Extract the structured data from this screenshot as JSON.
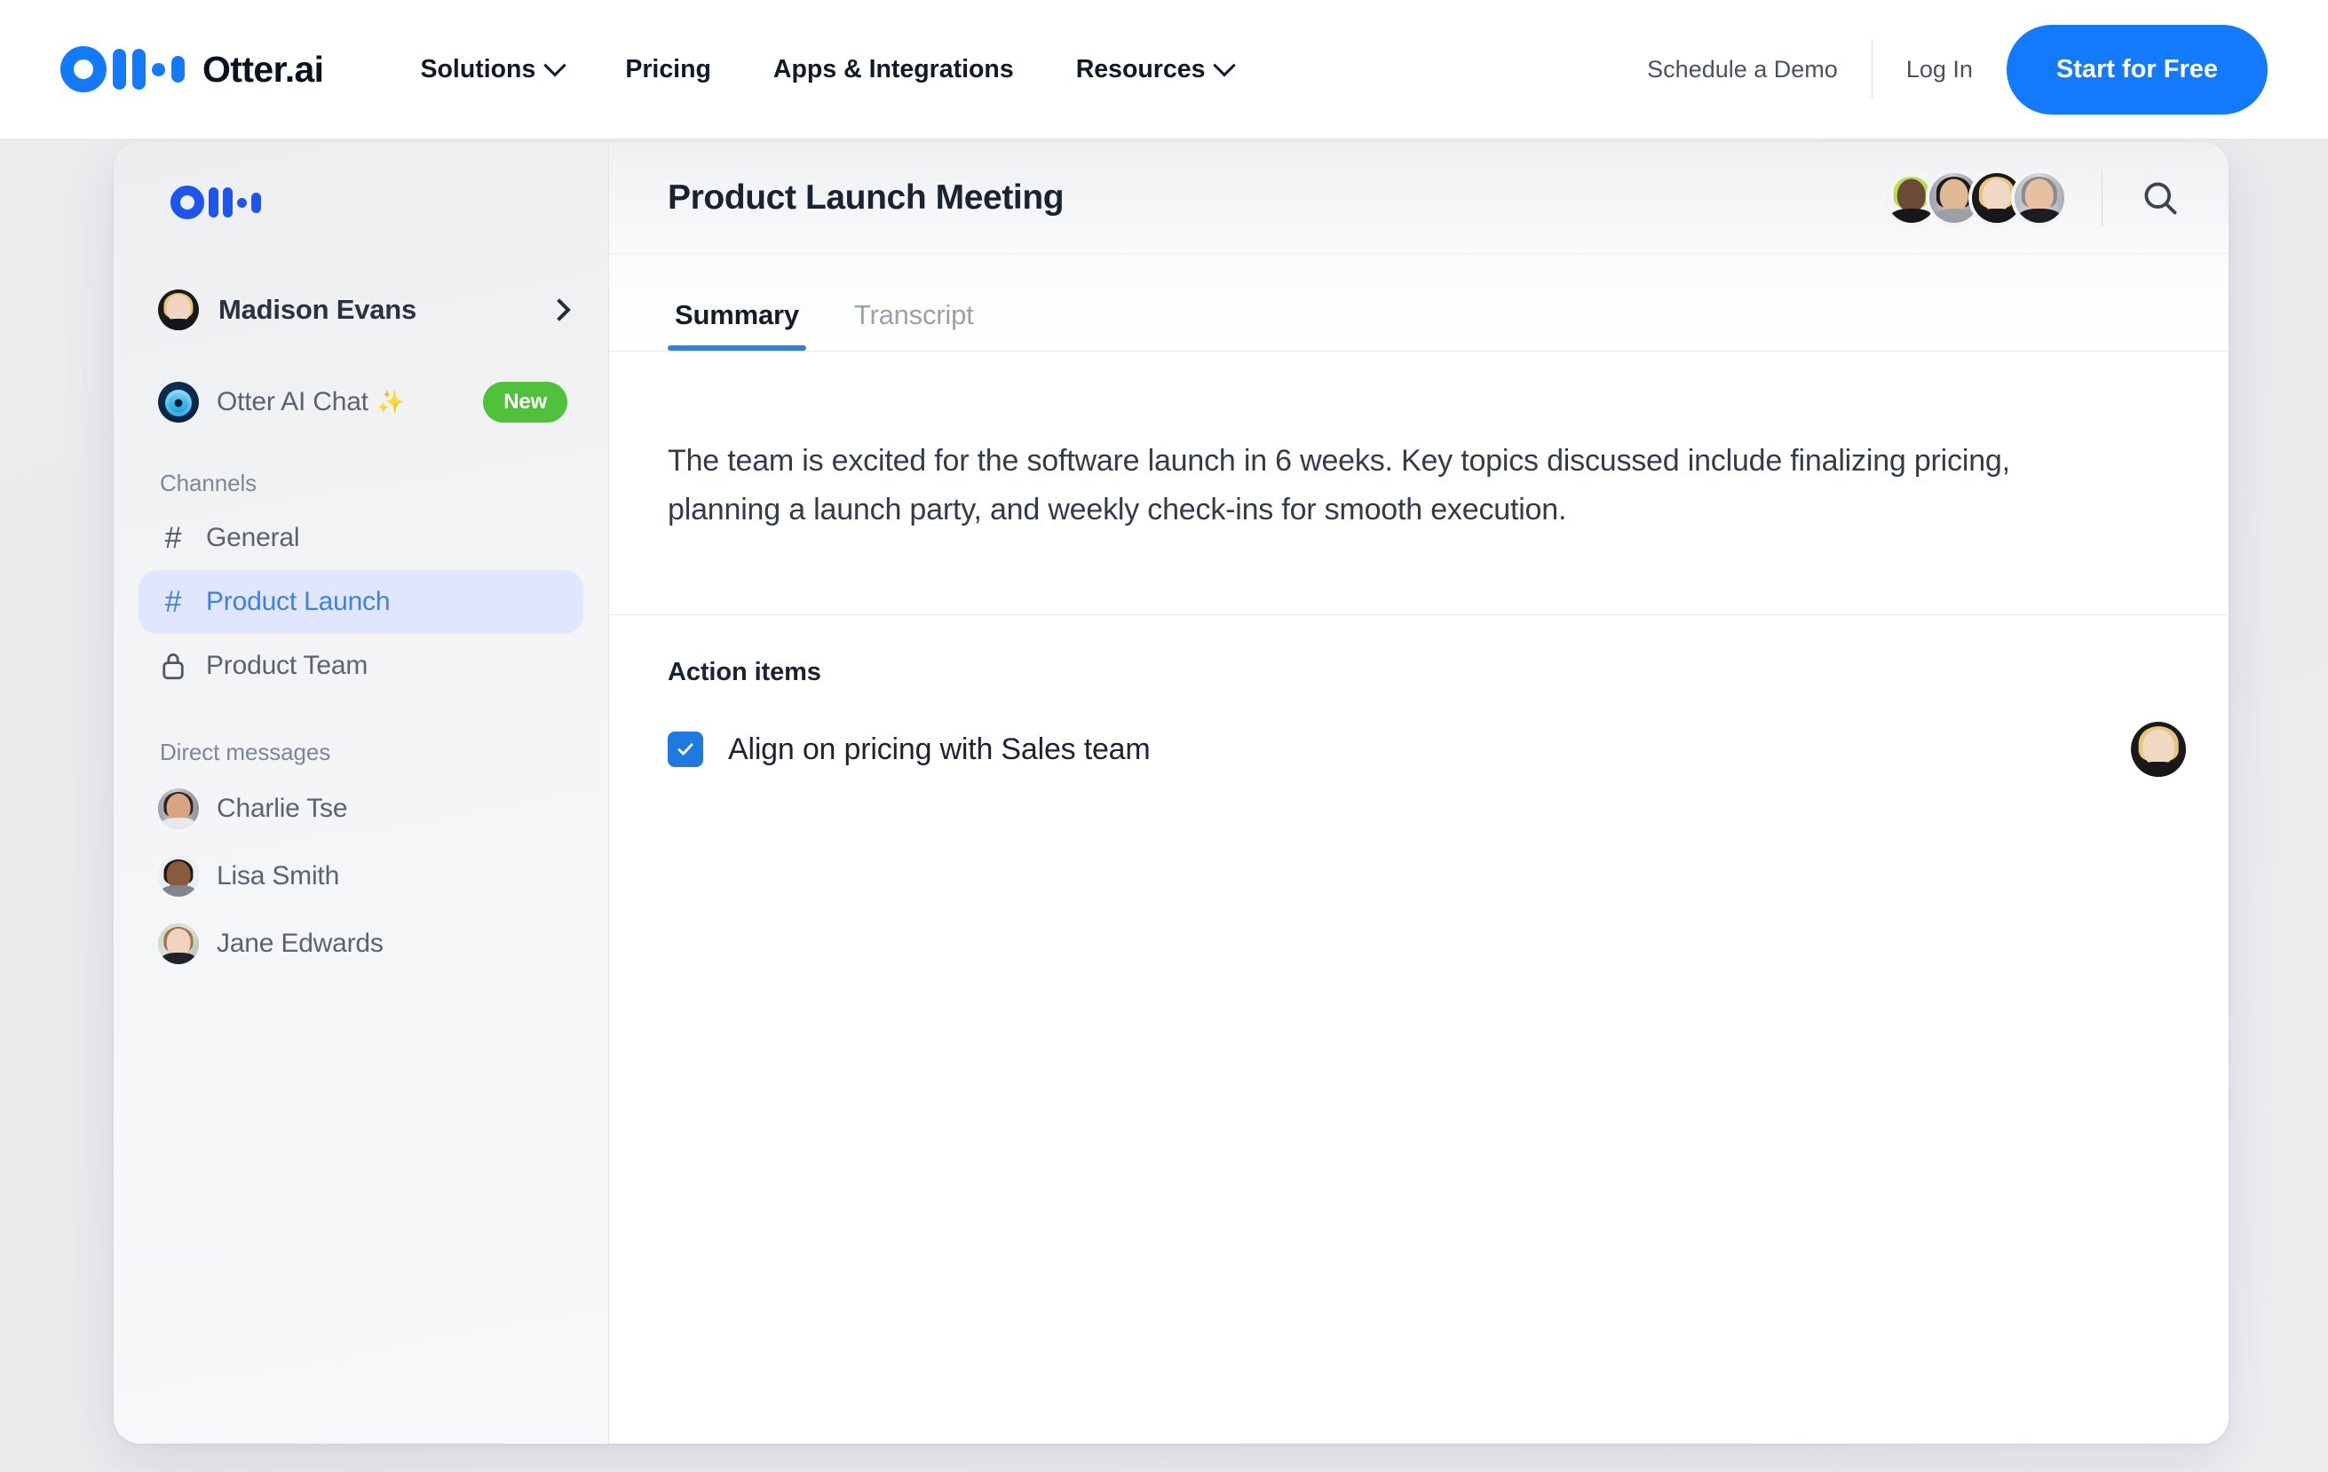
{
  "topnav": {
    "brand_name": "Otter.ai",
    "brand_logo_icon": "otter-waveform-logo",
    "links": [
      {
        "label": "Solutions",
        "has_dropdown": true
      },
      {
        "label": "Pricing",
        "has_dropdown": false
      },
      {
        "label": "Apps & Integrations",
        "has_dropdown": false
      },
      {
        "label": "Resources",
        "has_dropdown": true
      }
    ],
    "schedule_demo": "Schedule a Demo",
    "log_in": "Log In",
    "cta": "Start for Free",
    "accent_color": "#137bfb"
  },
  "app": {
    "sidebar": {
      "logo_icon": "otter-waveform-logo",
      "user": {
        "name": "Madison Evans",
        "chevron_icon": "chevron-right-icon"
      },
      "ai_chat": {
        "label": "Otter AI Chat",
        "sparkle": "✨",
        "badge": "New",
        "badge_color": "#4fc13a",
        "icon": "otter-ai-orb-icon"
      },
      "channels_heading": "Channels",
      "channels": [
        {
          "label": "General",
          "icon": "hash-icon",
          "active": false
        },
        {
          "label": "Product Launch",
          "icon": "hash-icon",
          "active": true
        },
        {
          "label": "Product Team",
          "icon": "lock-icon",
          "active": false
        }
      ],
      "dm_heading": "Direct messages",
      "direct_messages": [
        {
          "name": "Charlie Tse"
        },
        {
          "name": "Lisa Smith"
        },
        {
          "name": "Jane Edwards"
        }
      ],
      "active_channel_bg": "#dfe6fd",
      "active_channel_color": "#3f80e3"
    },
    "main": {
      "title": "Product Launch Meeting",
      "participant_count": 4,
      "search_icon": "search-icon",
      "tabs": [
        {
          "label": "Summary",
          "active": true
        },
        {
          "label": "Transcript",
          "active": false
        }
      ],
      "tab_indicator_color": "#2f7fe0",
      "summary": "The team is excited for the software launch in 6 weeks. Key topics discussed include finalizing pricing, planning a launch party, and weekly check-ins for smooth execution.",
      "action_items_heading": "Action items",
      "action_items": [
        {
          "text": "Align on pricing with Sales team",
          "checked": true,
          "checkbox_color": "#1f7ae0",
          "assignee_avatar": "assignee-avatar"
        }
      ]
    }
  }
}
